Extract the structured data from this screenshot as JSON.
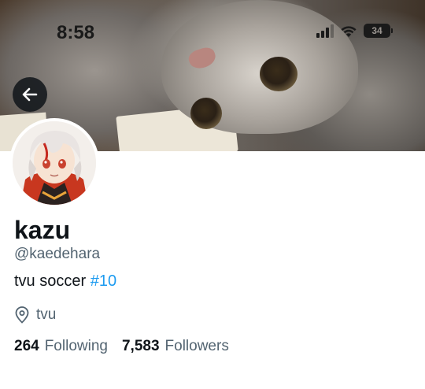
{
  "status_bar": {
    "time": "8:58",
    "battery": "34",
    "icons": [
      "signal-icon",
      "wifi-icon",
      "battery-icon"
    ]
  },
  "header": {
    "back_icon": "arrow-left-icon"
  },
  "profile": {
    "display_name": "kazu",
    "handle": "@kaedehara",
    "bio_text": "tvu soccer ",
    "bio_hashtag": "#10",
    "location": "tvu",
    "location_icon": "map-pin-icon",
    "following_count": "264",
    "following_label": "Following",
    "followers_count": "7,583",
    "followers_label": "Followers"
  },
  "colors": {
    "accent": "#1d9bf0",
    "secondary_text": "#536471",
    "primary_text": "#0f1419"
  }
}
